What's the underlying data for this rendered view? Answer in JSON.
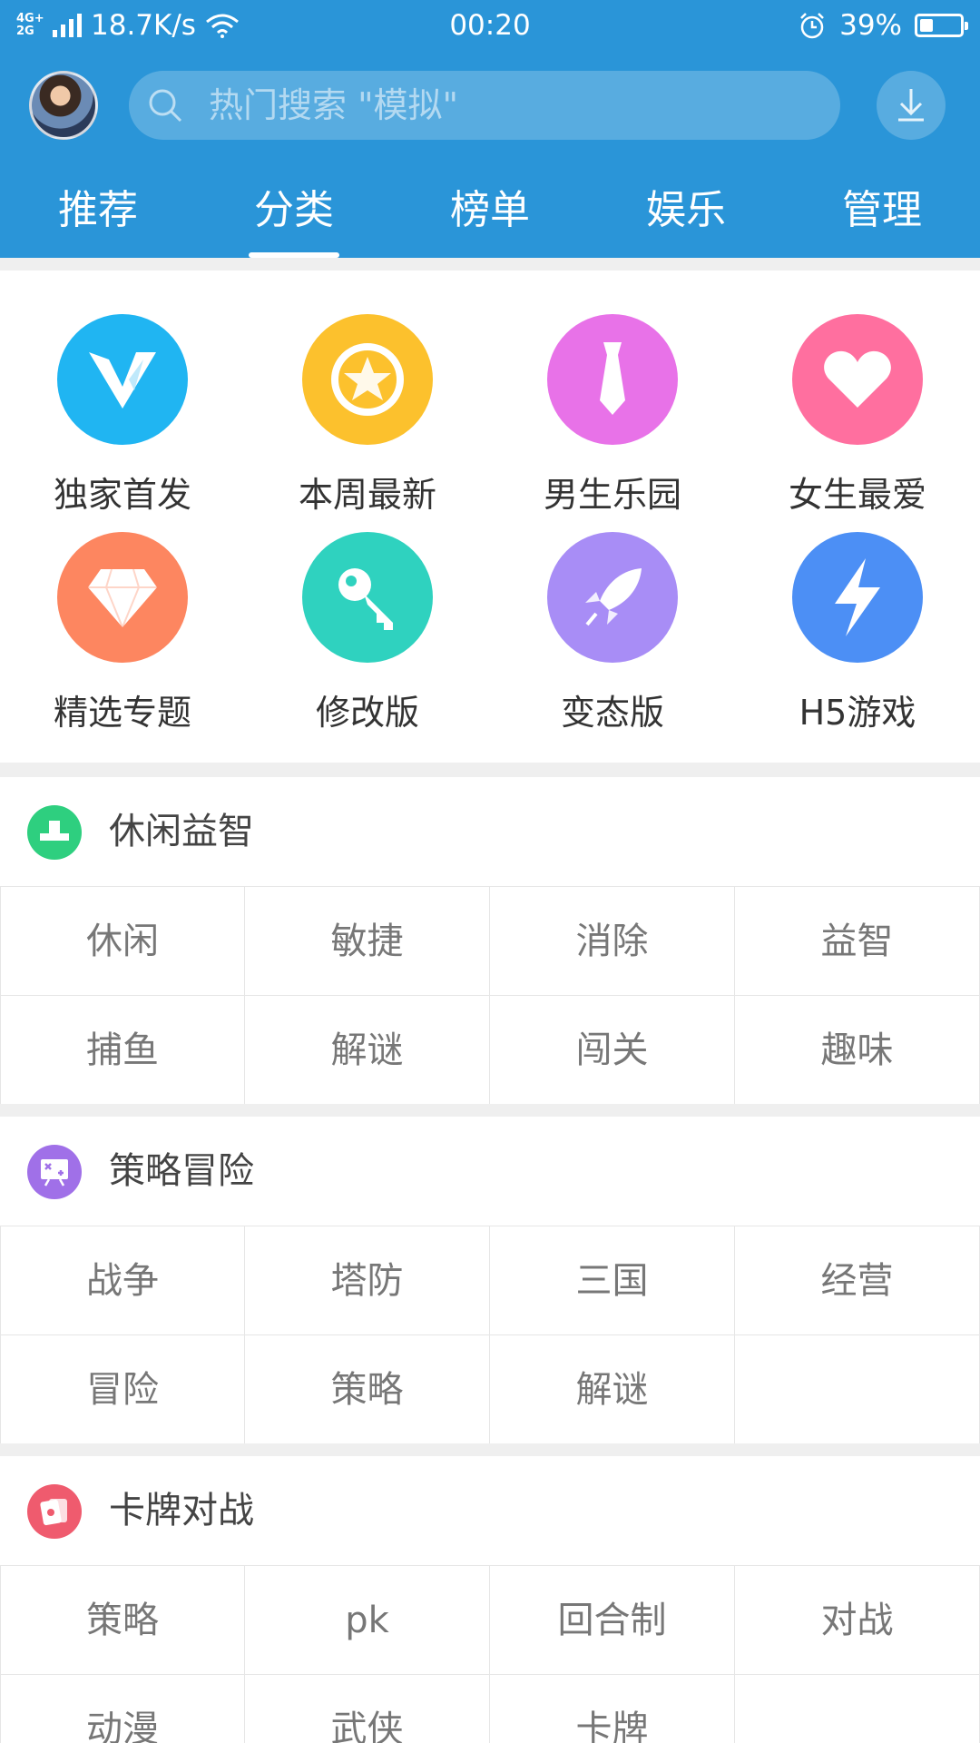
{
  "status_bar": {
    "network": "4G+ 2G",
    "speed": "18.7K/s",
    "time": "00:20",
    "battery": "39%"
  },
  "header": {
    "search_placeholder": "热门搜索 \"模拟\""
  },
  "tabs": [
    {
      "label": "推荐",
      "active": false
    },
    {
      "label": "分类",
      "active": true
    },
    {
      "label": "榜单",
      "active": false
    },
    {
      "label": "娱乐",
      "active": false
    },
    {
      "label": "管理",
      "active": false
    }
  ],
  "categories": [
    {
      "label": "独家首发",
      "icon": "v-logo-icon",
      "color": "#20b5f2"
    },
    {
      "label": "本周最新",
      "icon": "star-badge-icon",
      "color": "#fcc12d"
    },
    {
      "label": "男生乐园",
      "icon": "necktie-icon",
      "color": "#e872e8"
    },
    {
      "label": "女生最爱",
      "icon": "heart-icon",
      "color": "#ff6f9f"
    },
    {
      "label": "精选专题",
      "icon": "diamond-icon",
      "color": "#fd8660"
    },
    {
      "label": "修改版",
      "icon": "key-icon",
      "color": "#2fd2bf"
    },
    {
      "label": "变态版",
      "icon": "rocket-icon",
      "color": "#a88df6"
    },
    {
      "label": "H5游戏",
      "icon": "lightning-icon",
      "color": "#4c8ff5"
    }
  ],
  "sections": [
    {
      "title": "休闲益智",
      "icon": "puzzle-block-icon",
      "color": "#2ecf7f",
      "tags": [
        "休闲",
        "敏捷",
        "消除",
        "益智",
        "捕鱼",
        "解谜",
        "闯关",
        "趣味"
      ]
    },
    {
      "title": "策略冒险",
      "icon": "strategy-board-icon",
      "color": "#a070e8",
      "tags": [
        "战争",
        "塔防",
        "三国",
        "经营",
        "冒险",
        "策略",
        "解谜",
        ""
      ]
    },
    {
      "title": "卡牌对战",
      "icon": "cards-icon",
      "color": "#ef5b6e",
      "tags": [
        "策略",
        "pk",
        "回合制",
        "对战",
        "动漫",
        "武侠",
        "卡牌",
        ""
      ]
    }
  ]
}
